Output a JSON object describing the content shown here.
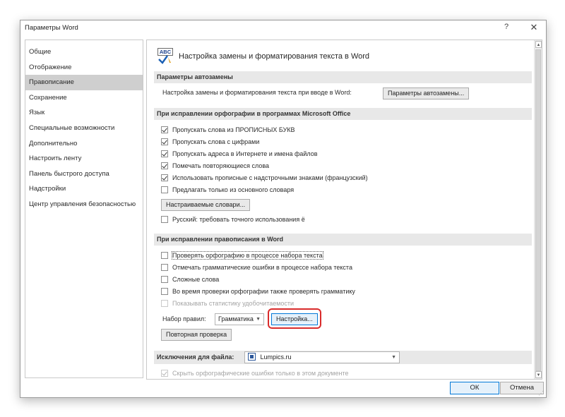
{
  "window": {
    "title": "Параметры Word",
    "help": "?",
    "close": "✕"
  },
  "sidebar": {
    "items": [
      {
        "label": "Общие"
      },
      {
        "label": "Отображение"
      },
      {
        "label": "Правописание",
        "active": true
      },
      {
        "label": "Сохранение"
      },
      {
        "label": "Язык"
      },
      {
        "label": "Специальные возможности"
      },
      {
        "label": "Дополнительно"
      },
      {
        "label": "Настроить ленту"
      },
      {
        "label": "Панель быстрого доступа"
      },
      {
        "label": "Надстройки"
      },
      {
        "label": "Центр управления безопасностью"
      }
    ]
  },
  "content": {
    "heading": "Настройка замены и форматирования текста в Word",
    "icon_text": "ABC",
    "autocorrect": {
      "section": "Параметры автозамены",
      "label": "Настройка замены и форматирования текста при вводе в Word:",
      "button": "Параметры автозамены..."
    },
    "office_spelling": {
      "section": "При исправлении орфографии в программах Microsoft Office",
      "options": [
        {
          "label": "Пропускать слова из ПРОПИСНЫХ БУКВ",
          "checked": true
        },
        {
          "label": "Пропускать слова с цифрами",
          "checked": true
        },
        {
          "label": "Пропускать адреса в Интернете и имена файлов",
          "checked": true
        },
        {
          "label": "Помечать повторяющиеся слова",
          "checked": true
        },
        {
          "label": "Использовать прописные с надстрочными знаками (французский)",
          "checked": true
        },
        {
          "label": "Предлагать только из основного словаря",
          "checked": false
        }
      ],
      "dictionaries_button": "Настраиваемые словари...",
      "russian_option": {
        "label": "Русский: требовать точного использования ё",
        "checked": false
      }
    },
    "word_spelling": {
      "section": "При исправлении правописания в Word",
      "options": [
        {
          "label": "Проверять орфографию в процессе набора текста",
          "checked": false
        },
        {
          "label": "Отмечать грамматические ошибки в процессе набора текста",
          "checked": false
        },
        {
          "label": "Сложные слова",
          "checked": false
        },
        {
          "label": "Во время проверки орфографии также проверять грамматику",
          "checked": false
        },
        {
          "label": "Показывать статистику удобочитаемости",
          "checked": false,
          "disabled": true
        }
      ],
      "rules_label": "Набор правил:",
      "rules_value": "Грамматика",
      "settings_button": "Настройка...",
      "recheck_button": "Повторная проверка"
    },
    "exceptions": {
      "section": "Исключения для файла:",
      "file_value": "Lumpics.ru",
      "option": {
        "label": "Скрыть орфографические ошибки только в этом документе",
        "checked": true,
        "disabled": true
      }
    }
  },
  "footer": {
    "ok": "ОК",
    "cancel": "Отмена"
  },
  "colors": {
    "highlight": "#d92b2b",
    "selected_sidebar": "#cfcfcf",
    "section_bg": "#e8e8e8",
    "primary_button_border": "#0078d7"
  }
}
